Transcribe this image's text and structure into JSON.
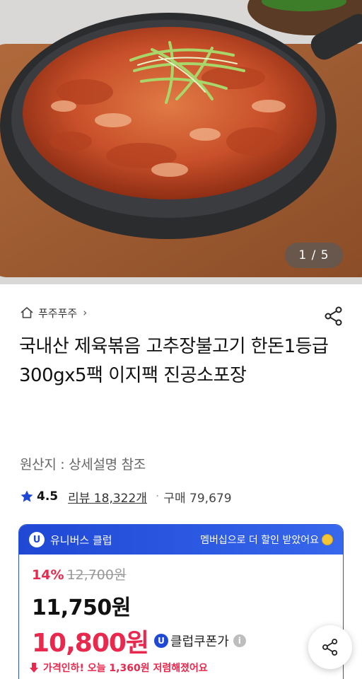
{
  "hero": {
    "image_counter": "1 / 5"
  },
  "store": {
    "name": "푸주푸주"
  },
  "product": {
    "title": "국내산 제육볶음 고추장불고기 한돈1등급 300gx5팩 이지팩 진공소포장",
    "origin": "원산지 : 상세설명 참조"
  },
  "rating": {
    "score": "4.5",
    "reviews": "리뷰 18,322개",
    "separator": "·",
    "purchases": "구매 79,679"
  },
  "club": {
    "badge": "U",
    "name": "유니버스 클럽",
    "message": "멤버십으로 더 할인 받았어요",
    "discount_rate": "14%",
    "original_price": "12,700원",
    "sale_price": "11,750원",
    "club_price": "10,800원",
    "coupon_label": "클럽쿠폰가",
    "info_symbol": "i",
    "price_drop_text": "가격인하! 오늘 1,360원 저렴해졌어요"
  },
  "colors": {
    "accent_blue": "#1f48d4",
    "price_red": "#e8284d"
  }
}
